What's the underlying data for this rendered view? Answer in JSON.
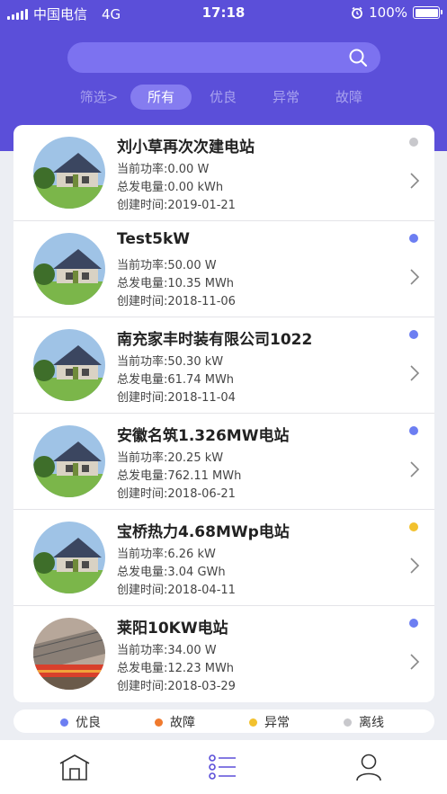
{
  "status_bar": {
    "carrier": "中国电信",
    "network": "4G",
    "time": "17:18",
    "battery": "100%"
  },
  "search": {
    "placeholder": "",
    "icon": "search-icon"
  },
  "filters": [
    {
      "label": "筛选>",
      "active": false
    },
    {
      "label": "所有",
      "active": true
    },
    {
      "label": "优良",
      "active": false
    },
    {
      "label": "异常",
      "active": false
    },
    {
      "label": "故障",
      "active": false
    }
  ],
  "stations": [
    {
      "name": "刘小草再次次建电站",
      "power": "当前功率:0.00 W",
      "energy": "总发电量:0.00 kWh",
      "created": "创建时间:2019-01-21",
      "status": "offline",
      "status_color": "#c8c8cc",
      "image": "house-photo"
    },
    {
      "name": "Test5kW",
      "power": "当前功率:50.00 W",
      "energy": "总发电量:10.35 MWh",
      "created": "创建时间:2018-11-06",
      "status": "good",
      "status_color": "#6c7ef2",
      "image": "house-photo"
    },
    {
      "name": "南充家丰时装有限公司1022",
      "power": "当前功率:50.30 kW",
      "energy": "总发电量:61.74 MWh",
      "created": "创建时间:2018-11-04",
      "status": "good",
      "status_color": "#6c7ef2",
      "image": "house-photo"
    },
    {
      "name": "安徽名筑1.326MW电站",
      "power": "当前功率:20.25 kW",
      "energy": "总发电量:762.11 MWh",
      "created": "创建时间:2018-06-21",
      "status": "good",
      "status_color": "#6c7ef2",
      "image": "house-photo"
    },
    {
      "name": "宝桥热力4.68MWp电站",
      "power": "当前功率:6.26 kW",
      "energy": "总发电量:3.04 GWh",
      "created": "创建时间:2018-04-11",
      "status": "abnormal",
      "status_color": "#f2c12e",
      "image": "house-photo"
    },
    {
      "name": "莱阳10KW电站",
      "power": "当前功率:34.00 W",
      "energy": "总发电量:12.23 MWh",
      "created": "创建时间:2018-03-29",
      "status": "good",
      "status_color": "#6c7ef2",
      "image": "rooftop-photo"
    }
  ],
  "legend": [
    {
      "label": "优良",
      "color": "#6c7ef2"
    },
    {
      "label": "故障",
      "color": "#f07a2e"
    },
    {
      "label": "异常",
      "color": "#f2c12e"
    },
    {
      "label": "离线",
      "color": "#c8c8cc"
    }
  ],
  "tabbar": [
    {
      "icon": "home-icon",
      "active": false
    },
    {
      "icon": "list-icon",
      "active": true
    },
    {
      "icon": "user-icon",
      "active": false
    }
  ],
  "colors": {
    "header": "#5b4fd9",
    "accent": "#5b4fd9",
    "inactive_icon": "#333333"
  }
}
